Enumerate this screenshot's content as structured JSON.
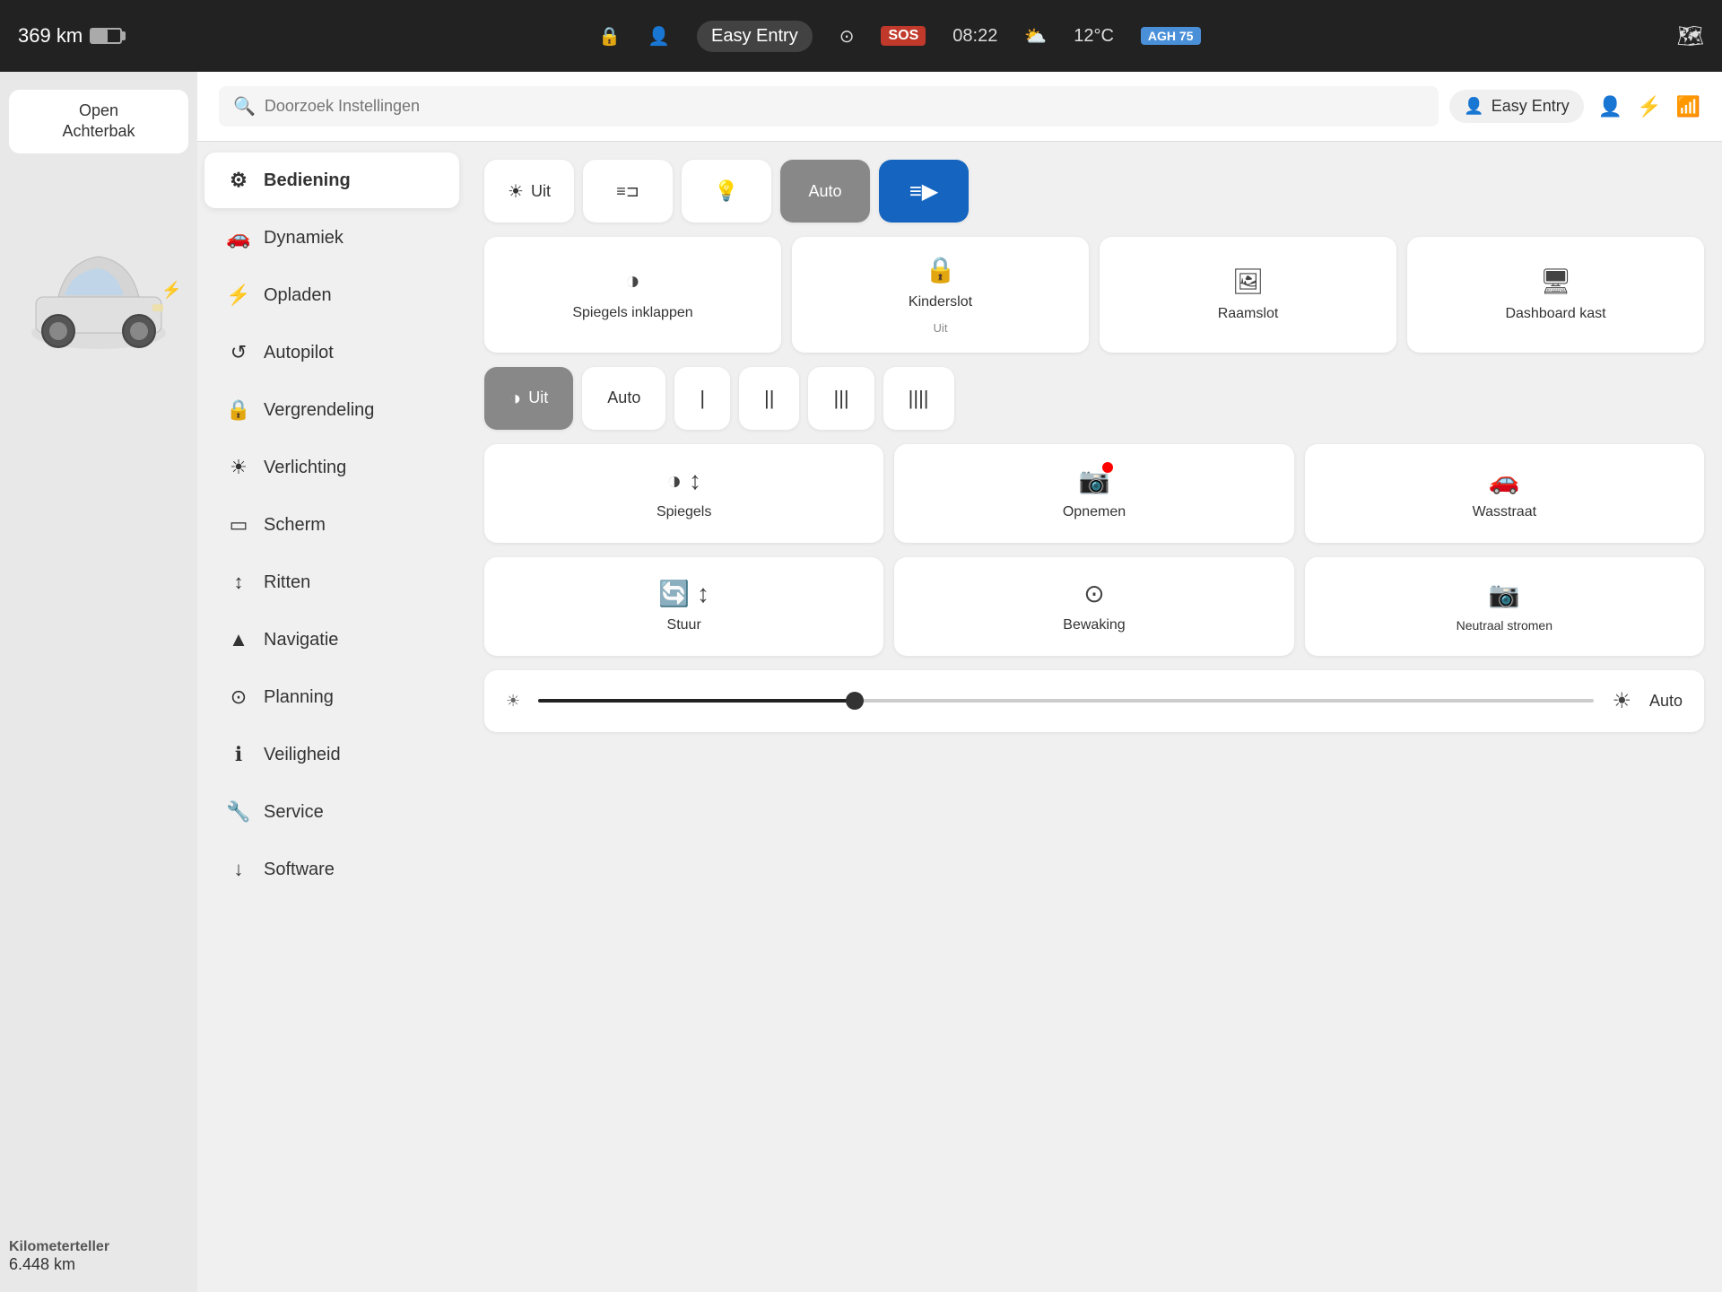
{
  "statusBar": {
    "km": "369 km",
    "easyEntry": "Easy Entry",
    "time": "08:22",
    "temp": "12°C",
    "autoPilot": "AGH 75",
    "sosLabel": "SOS"
  },
  "leftPanel": {
    "openTrunkLine1": "Open",
    "openTrunkLine2": "Achterbak",
    "kmCounterTitle": "Kilometerteller",
    "kmCounterValue": "6.448 km"
  },
  "searchBar": {
    "placeholder": "Doorzoek Instellingen",
    "profileName": "Easy Entry"
  },
  "navMenu": {
    "items": [
      {
        "id": "bediening",
        "label": "Bediening",
        "icon": "⚙",
        "active": true
      },
      {
        "id": "dynamiek",
        "label": "Dynamiek",
        "icon": "🚗"
      },
      {
        "id": "opladen",
        "label": "Opladen",
        "icon": "⚡"
      },
      {
        "id": "autopilot",
        "label": "Autopilot",
        "icon": "🔄"
      },
      {
        "id": "vergrendeling",
        "label": "Vergrendeling",
        "icon": "🔒"
      },
      {
        "id": "verlichting",
        "label": "Verlichting",
        "icon": "☀"
      },
      {
        "id": "scherm",
        "label": "Scherm",
        "icon": "🖥"
      },
      {
        "id": "ritten",
        "label": "Ritten",
        "icon": "↕"
      },
      {
        "id": "navigatie",
        "label": "Navigatie",
        "icon": "▲"
      },
      {
        "id": "planning",
        "label": "Planning",
        "icon": "🕐"
      },
      {
        "id": "veiligheid",
        "label": "Veiligheid",
        "icon": "ℹ"
      },
      {
        "id": "service",
        "label": "Service",
        "icon": "🔧"
      },
      {
        "id": "software",
        "label": "Software",
        "icon": "↓"
      }
    ]
  },
  "controls": {
    "lightButtons": [
      {
        "id": "uit",
        "label": "Uit",
        "icon": "☀",
        "active": false
      },
      {
        "id": "dge",
        "label": "DGE",
        "active": false
      },
      {
        "id": "dimlicht",
        "label": "",
        "icon": "💡",
        "active": false
      },
      {
        "id": "auto",
        "label": "Auto",
        "active": true
      },
      {
        "id": "groot",
        "label": "",
        "icon": "💡💡",
        "active": false,
        "primary": true
      }
    ],
    "featureButtons": [
      {
        "id": "spiegels",
        "label": "Spiegels inklappen",
        "icon": "◑"
      },
      {
        "id": "kinderslot",
        "label": "Kinderslot",
        "sublabel": "Uit",
        "icon": "🔒"
      },
      {
        "id": "raamslot",
        "label": "Raamslot",
        "icon": "🖼"
      },
      {
        "id": "dashboard",
        "label": "Dashboard kast",
        "icon": "🖥"
      }
    ],
    "wiperButtons": [
      {
        "id": "uit",
        "label": "Uit",
        "icon": "◑",
        "active": true
      },
      {
        "id": "auto",
        "label": "Auto",
        "active": false
      },
      {
        "id": "speed1",
        "label": "I",
        "active": false
      },
      {
        "id": "speed2",
        "label": "II",
        "active": false
      },
      {
        "id": "speed3",
        "label": "III",
        "active": false
      },
      {
        "id": "speed4",
        "label": "IIII",
        "active": false
      }
    ],
    "actionButtons": [
      {
        "id": "spiegels2",
        "label": "Spiegels",
        "icon": "◑↕",
        "hasArrow": true
      },
      {
        "id": "opnemen",
        "label": "Opnemen",
        "icon": "📷",
        "hasRedDot": true
      },
      {
        "id": "wasstraat",
        "label": "Wasstraat",
        "icon": "🚗"
      }
    ],
    "stuurButtons": [
      {
        "id": "stuur",
        "label": "Stuur",
        "icon": "🔄↕"
      },
      {
        "id": "bewaking",
        "label": "Bewaking",
        "icon": "🔵"
      },
      {
        "id": "neutraal",
        "label": "Neutraal stromen",
        "icon": "📷"
      }
    ],
    "brightness": {
      "autoLabel": "Auto",
      "sliderValue": 30
    }
  }
}
